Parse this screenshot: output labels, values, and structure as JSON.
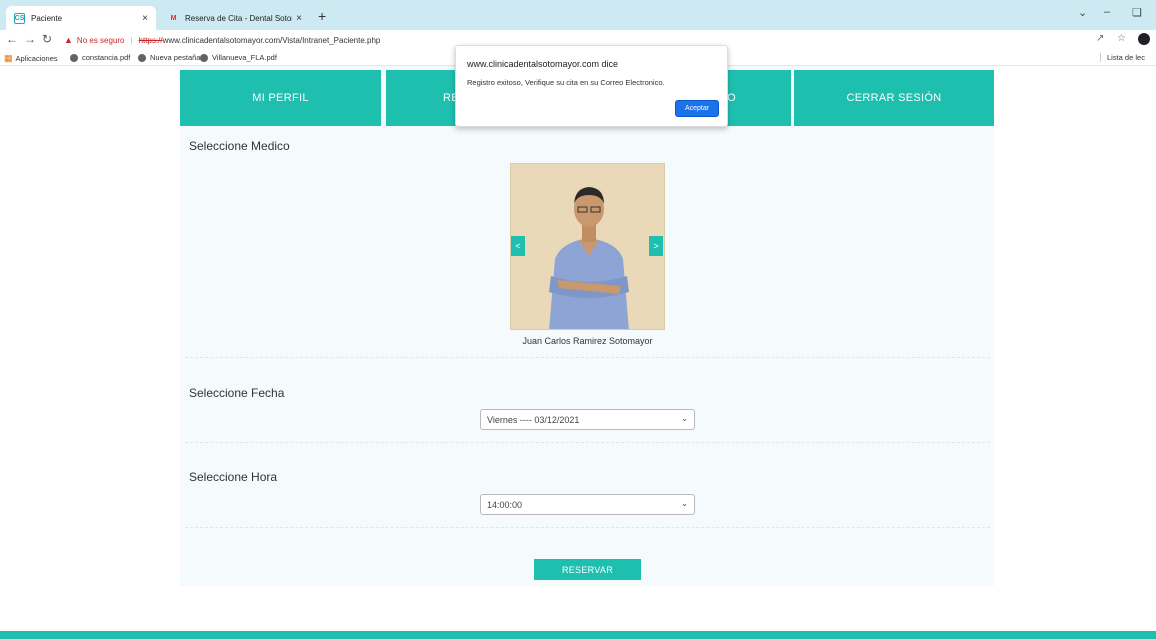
{
  "browser": {
    "tabs": [
      {
        "label": "Paciente",
        "favicon": "cs-favicon",
        "close": "×"
      },
      {
        "label": "Reserva de Cita - Dental Sotoma",
        "favicon": "gmail-icon",
        "close": "×"
      }
    ],
    "new_tab": "+",
    "address": {
      "security_label": "No es seguro",
      "scheme": "https://",
      "url_rest": "www.clinicadentalsotomayor.com/Vista/Intranet_Paciente.php"
    },
    "bookmarks": [
      {
        "label": "Aplicaciones"
      },
      {
        "label": "constancia.pdf"
      },
      {
        "label": "Nueva pestaña"
      },
      {
        "label": "Villanueva_FLA.pdf"
      }
    ],
    "reading_list": "Lista de lec"
  },
  "nav": {
    "profile": "MI PERFIL",
    "reserve_partial": "RE",
    "history_partial": "CO",
    "logout": "CERRAR SESIÓN"
  },
  "doctor_section": {
    "title": "Seleccione Medico",
    "doctor_name": "Juan Carlos Ramirez Sotomayor",
    "prev": "<",
    "next": ">"
  },
  "date_section": {
    "title": "Seleccione Fecha",
    "value": "Viernes ---- 03/12/2021"
  },
  "time_section": {
    "title": "Seleccione Hora",
    "value": "14:00:00"
  },
  "reserve_button": "RESERVAR",
  "alert": {
    "origin": "www.clinicadentalsotomayor.com dice",
    "message": "Registro exitoso, Verifique su cita en su Correo Electronico.",
    "ok": "Aceptar"
  },
  "colors": {
    "accent": "#1fbfb0",
    "alert_button": "#1a73e8"
  }
}
